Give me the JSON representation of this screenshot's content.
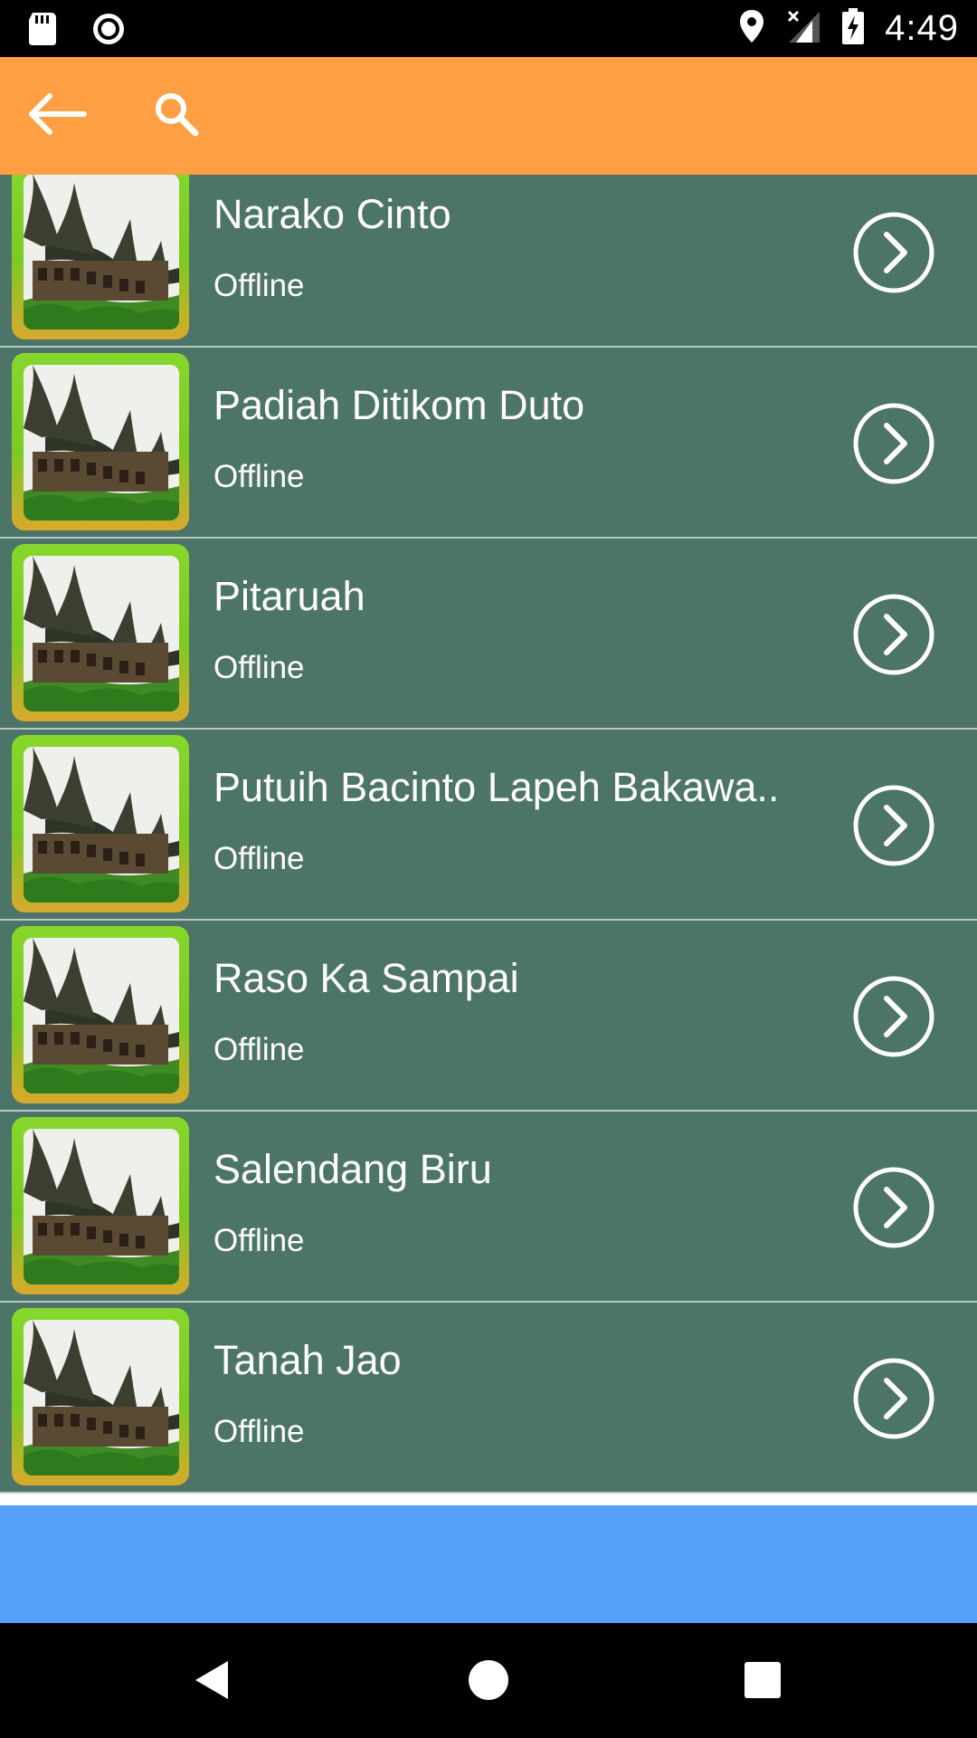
{
  "status_bar": {
    "time": "4:49",
    "icons": [
      "sd-card-icon",
      "record-icon",
      "location-icon",
      "signal-icon",
      "battery-charging-icon"
    ]
  },
  "app_bar": {
    "background": "#ff9f43",
    "icons": [
      "back-arrow-icon",
      "search-icon"
    ]
  },
  "list": {
    "item_background": "#4c7468",
    "items": [
      {
        "title": "Narako Cinto",
        "subtitle": "Offline"
      },
      {
        "title": "Padiah Ditikom Duto",
        "subtitle": "Offline"
      },
      {
        "title": "Pitaruah",
        "subtitle": "Offline"
      },
      {
        "title": "Putuih Bacinto Lapeh Bakawa..",
        "subtitle": "Offline"
      },
      {
        "title": "Raso Ka Sampai",
        "subtitle": "Offline"
      },
      {
        "title": "Salendang Biru",
        "subtitle": "Offline"
      },
      {
        "title": "Tanah Jao",
        "subtitle": "Offline"
      }
    ]
  },
  "banner": {
    "background": "#56a0fb"
  },
  "nav_bar": {
    "icons": [
      "back-triangle-icon",
      "home-circle-icon",
      "recents-square-icon"
    ]
  }
}
